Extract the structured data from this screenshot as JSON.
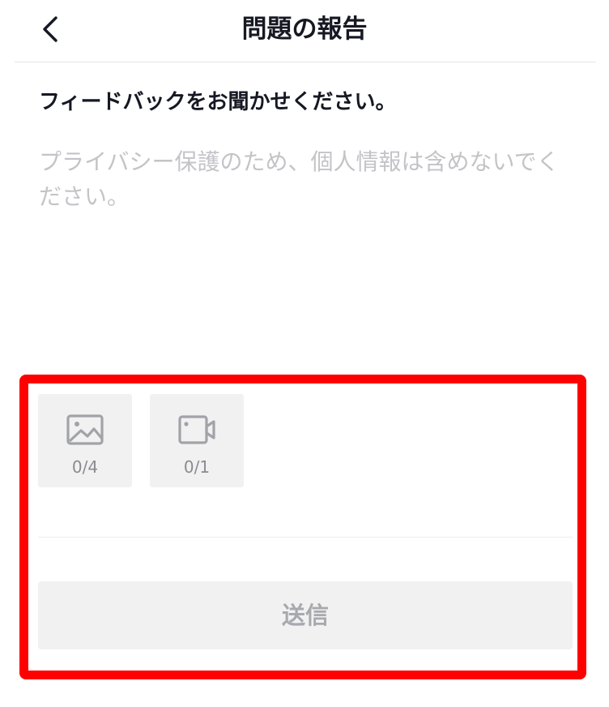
{
  "header": {
    "back_icon": "chevron-left-icon",
    "title": "問題の報告"
  },
  "prompt": {
    "heading": "フィードバックをお聞かせください。"
  },
  "feedback": {
    "value": "",
    "placeholder": "プライバシー保護のため、個人情報は含めないでください。"
  },
  "attachments": {
    "photo": {
      "icon": "image-icon",
      "count": "0/4"
    },
    "video": {
      "icon": "video-camera-icon",
      "count": "0/1"
    }
  },
  "submit": {
    "label": "送信"
  },
  "colors": {
    "highlight": "#ff0000",
    "tile_bg": "#f1f1f2",
    "icon_gray": "#a2a3a8",
    "placeholder": "#c4c4c8",
    "disabled_text": "#a8a9ae"
  }
}
